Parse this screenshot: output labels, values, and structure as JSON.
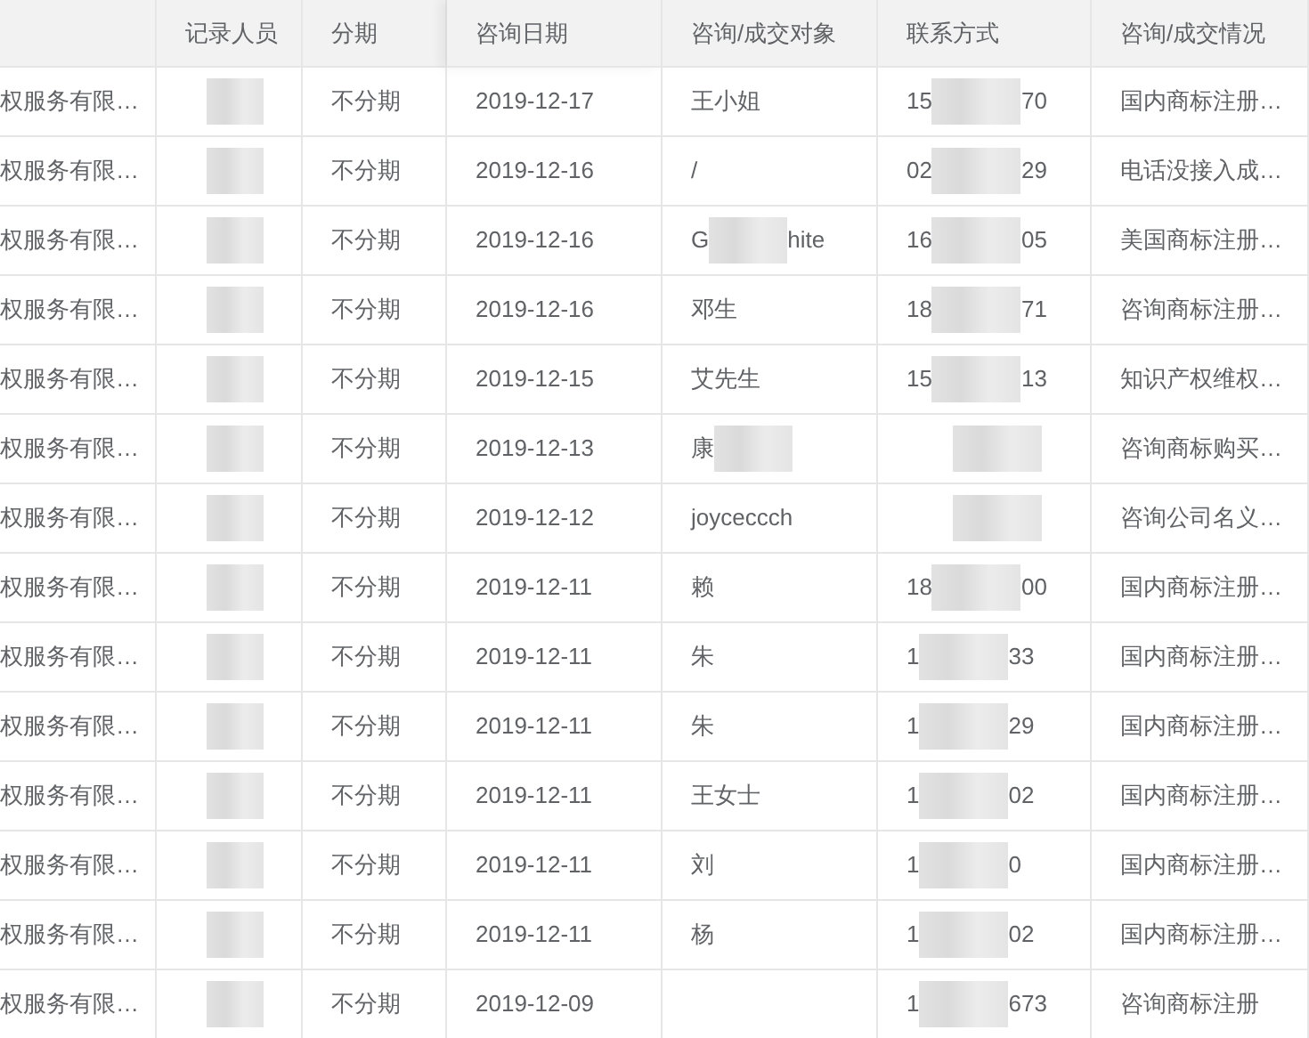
{
  "table": {
    "columns": [
      "记录人员",
      "分期",
      "咨询日期",
      "咨询/成交对象",
      "联系方式",
      "咨询/成交情况"
    ],
    "rows": [
      {
        "company": "权服务有限…",
        "recorder": {
          "masked": true
        },
        "installment": "不分期",
        "date": "2019-12-17",
        "client": {
          "prefix": "王小姐"
        },
        "contact": {
          "prefix": "15",
          "masked": true,
          "suffix": "70"
        },
        "status": "国内商标注册…"
      },
      {
        "company": "权服务有限…",
        "recorder": {
          "masked": true
        },
        "installment": "不分期",
        "date": "2019-12-16",
        "client": {
          "prefix": "/"
        },
        "contact": {
          "prefix": "02",
          "masked": true,
          "suffix": "29"
        },
        "status": "电话没接入成…"
      },
      {
        "company": "权服务有限…",
        "recorder": {
          "masked": true
        },
        "installment": "不分期",
        "date": "2019-12-16",
        "client": {
          "prefix": "G",
          "masked": true,
          "suffix": "hite"
        },
        "contact": {
          "prefix": "16",
          "masked": true,
          "suffix": "05"
        },
        "status": "美国商标注册…"
      },
      {
        "company": "权服务有限…",
        "recorder": {
          "masked": true
        },
        "installment": "不分期",
        "date": "2019-12-16",
        "client": {
          "prefix": "邓生"
        },
        "contact": {
          "prefix": "18",
          "masked": true,
          "suffix": "71"
        },
        "status": "咨询商标注册…"
      },
      {
        "company": "权服务有限…",
        "recorder": {
          "masked": true
        },
        "installment": "不分期",
        "date": "2019-12-15",
        "client": {
          "prefix": "艾先生"
        },
        "contact": {
          "prefix": "15",
          "masked": true,
          "suffix": "13"
        },
        "status": "知识产权维权…"
      },
      {
        "company": "权服务有限…",
        "recorder": {
          "masked": true
        },
        "installment": "不分期",
        "date": "2019-12-13",
        "client": {
          "prefix": "康",
          "masked": true
        },
        "contact": {
          "masked": true
        },
        "status": "咨询商标购买…"
      },
      {
        "company": "权服务有限…",
        "recorder": {
          "masked": true
        },
        "installment": "不分期",
        "date": "2019-12-12",
        "client": {
          "prefix": "joyceccch"
        },
        "contact": {
          "masked": true
        },
        "status": "咨询公司名义…"
      },
      {
        "company": "权服务有限…",
        "recorder": {
          "masked": true
        },
        "installment": "不分期",
        "date": "2019-12-11",
        "client": {
          "prefix": "赖"
        },
        "contact": {
          "prefix": "18",
          "masked": true,
          "suffix": "00"
        },
        "status": "国内商标注册…"
      },
      {
        "company": "权服务有限…",
        "recorder": {
          "masked": true
        },
        "installment": "不分期",
        "date": "2019-12-11",
        "client": {
          "prefix": "朱"
        },
        "contact": {
          "prefix": "1",
          "masked": true,
          "suffix": "33"
        },
        "status": "国内商标注册…"
      },
      {
        "company": "权服务有限…",
        "recorder": {
          "masked": true
        },
        "installment": "不分期",
        "date": "2019-12-11",
        "client": {
          "prefix": "朱"
        },
        "contact": {
          "prefix": "1",
          "masked": true,
          "suffix": "29"
        },
        "status": "国内商标注册…"
      },
      {
        "company": "权服务有限…",
        "recorder": {
          "masked": true
        },
        "installment": "不分期",
        "date": "2019-12-11",
        "client": {
          "prefix": "王女士"
        },
        "contact": {
          "prefix": "1",
          "masked": true,
          "suffix": "02"
        },
        "status": "国内商标注册…"
      },
      {
        "company": "权服务有限…",
        "recorder": {
          "masked": true
        },
        "installment": "不分期",
        "date": "2019-12-11",
        "client": {
          "prefix": "刘"
        },
        "contact": {
          "prefix": "1",
          "masked": true,
          "suffix": "0"
        },
        "status": "国内商标注册…"
      },
      {
        "company": "权服务有限…",
        "recorder": {
          "masked": true
        },
        "installment": "不分期",
        "date": "2019-12-11",
        "client": {
          "prefix": "杨"
        },
        "contact": {
          "prefix": "1",
          "masked": true,
          "suffix": "02"
        },
        "status": "国内商标注册…"
      },
      {
        "company": "权服务有限…",
        "recorder": {
          "masked": true
        },
        "installment": "不分期",
        "date": "2019-12-09",
        "client": {},
        "contact": {
          "prefix": "1",
          "masked": true,
          "suffix": "673"
        },
        "status": "咨询商标注册"
      }
    ]
  }
}
